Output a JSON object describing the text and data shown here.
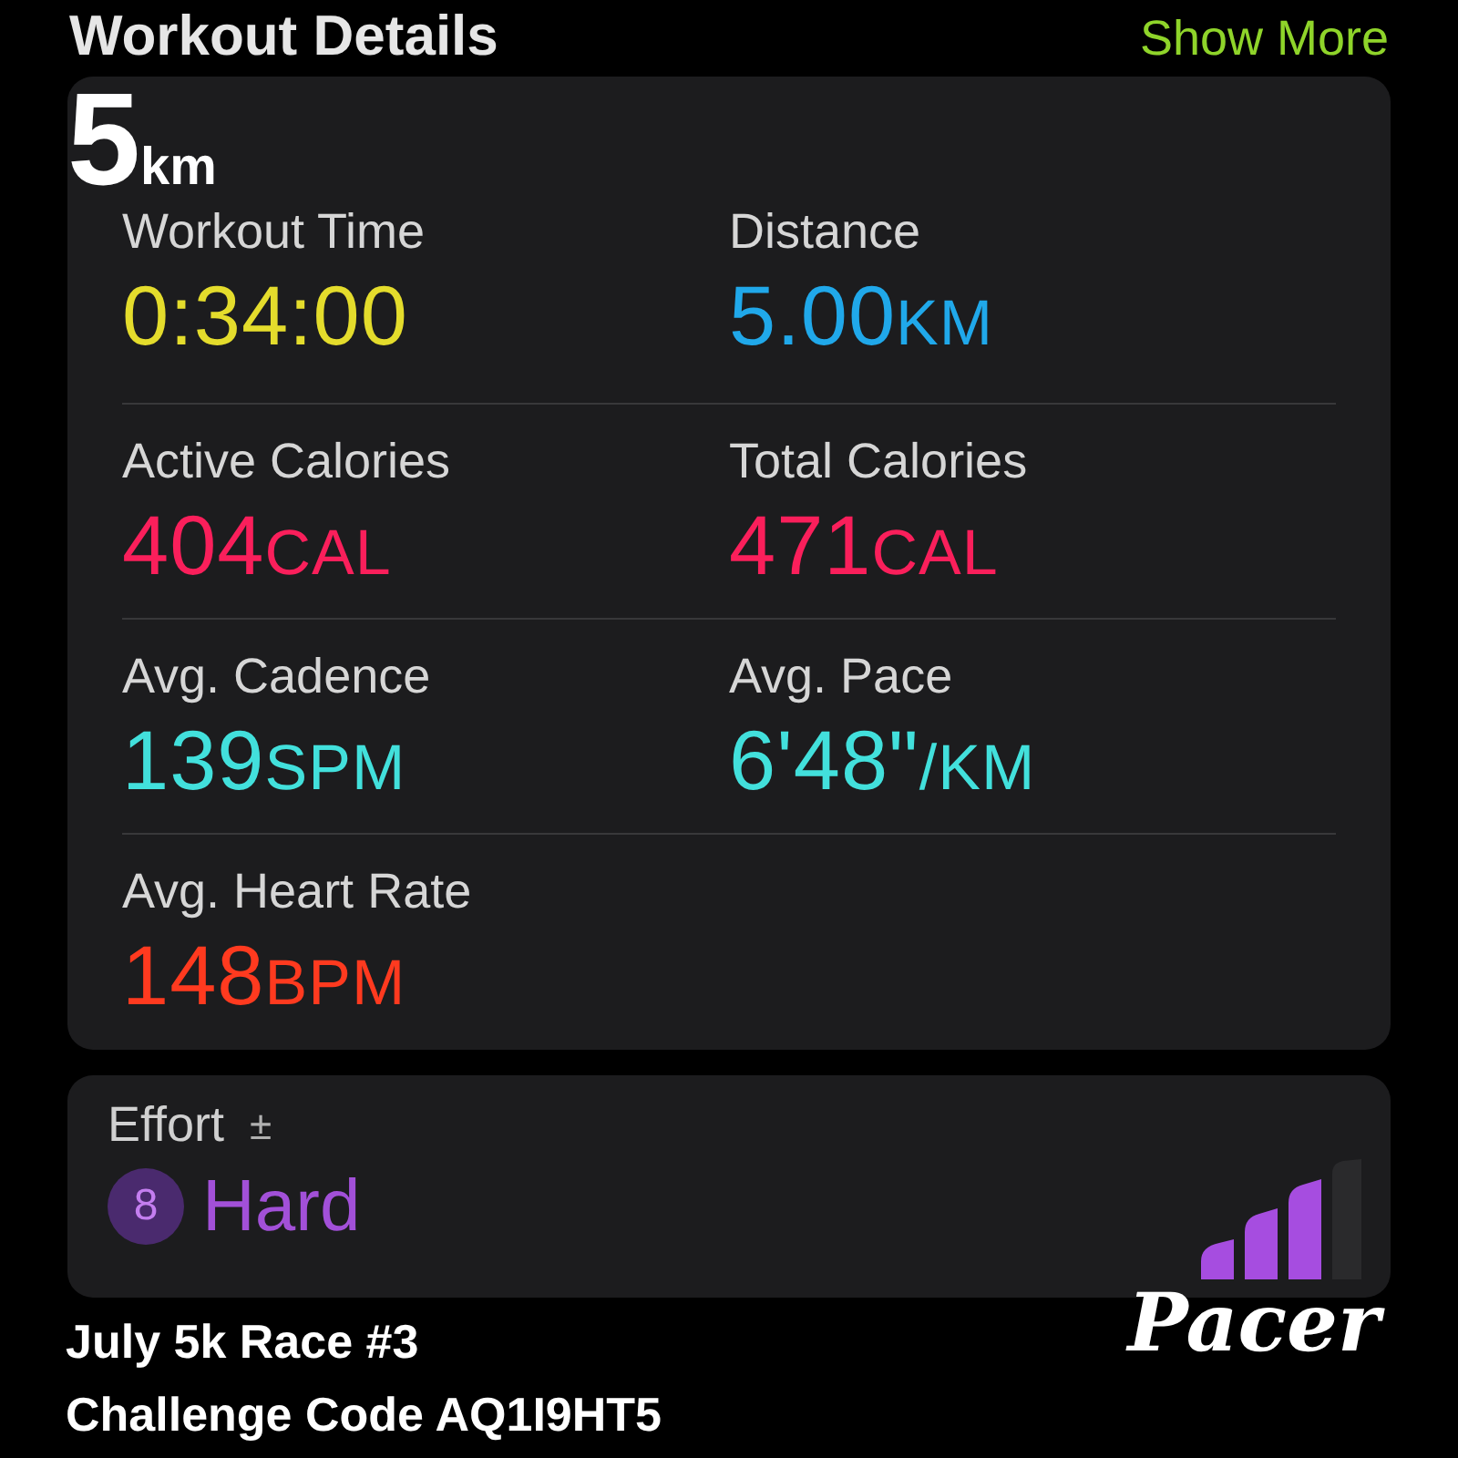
{
  "header": {
    "title": "Workout Details",
    "action": "Show More"
  },
  "metrics": [
    {
      "label": "Workout Time",
      "value": "0:34:00",
      "color": "#e4dc2c"
    },
    {
      "label": "Distance",
      "value": "5.00",
      "unit": "KM",
      "color": "#20a8ea"
    },
    {
      "label": "Active Calories",
      "value": "404",
      "unit": "CAL",
      "color": "#fa1f5b"
    },
    {
      "label": "Total Calories",
      "value": "471",
      "unit": "CAL",
      "color": "#fa1f5b"
    },
    {
      "label": "Avg. Cadence",
      "value": "139",
      "unit": "SPM",
      "color": "#42e0dc"
    },
    {
      "label": "Avg. Pace",
      "value": "6'48\"",
      "unit": "/KM",
      "color": "#42e0dc"
    },
    {
      "label": "Avg. Heart Rate",
      "value": "148",
      "unit": "BPM",
      "color": "#ff3a1f"
    }
  ],
  "effort": {
    "label": "Effort",
    "adjust": "±",
    "score": "8",
    "rating": "Hard"
  },
  "overlay": {
    "distance": "5",
    "distance_unit": "km",
    "challenge": "July 5k Race #3",
    "code": "Challenge Code AQ1I9HT5",
    "brand": "Pacer"
  }
}
